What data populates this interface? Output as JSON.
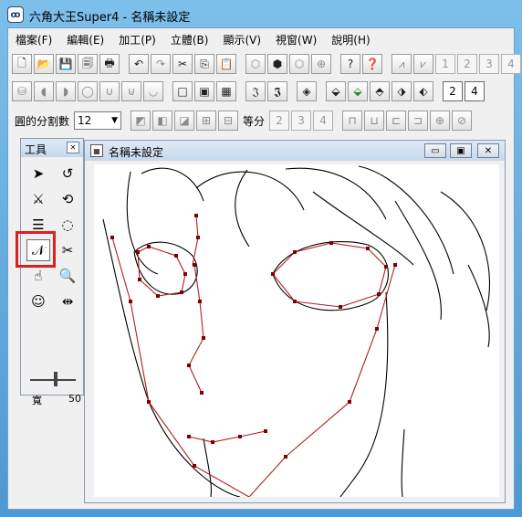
{
  "window": {
    "title": "六角大王Super4 - 名稱未設定",
    "icon_text": "ꝏ"
  },
  "menu": [
    "檔案(F)",
    "編輯(E)",
    "加工(P)",
    "立體(B)",
    "顯示(V)",
    "視窗(W)",
    "說明(H)"
  ],
  "toolbar1": {
    "buttons": [
      "📄",
      "📂",
      "💾",
      "🗐",
      "🖨",
      "↶",
      "↷",
      "✂",
      "⎘",
      "📋",
      "⬡",
      "⬢",
      "⬡",
      "⬡",
      "?",
      "?"
    ],
    "numbers": [
      "1",
      "2",
      "3",
      "4"
    ]
  },
  "toolbar2": {
    "numbers": [
      "2",
      "4"
    ]
  },
  "toolbar3": {
    "circle_div_label": "圓的分割數",
    "circle_div_value": "12",
    "equal_label": "等分",
    "equal_numbers": [
      "2",
      "3",
      "4"
    ]
  },
  "tool_window": {
    "title": "工具",
    "width_label": "寬",
    "width_value": "50",
    "tools": [
      "➤",
      "↺",
      "✕",
      "⟳",
      "☰",
      "◌",
      "N",
      "✂",
      "☚",
      "🔍",
      "⊜",
      "ꟷ"
    ]
  },
  "canvas_window": {
    "title": "名稱未設定"
  }
}
